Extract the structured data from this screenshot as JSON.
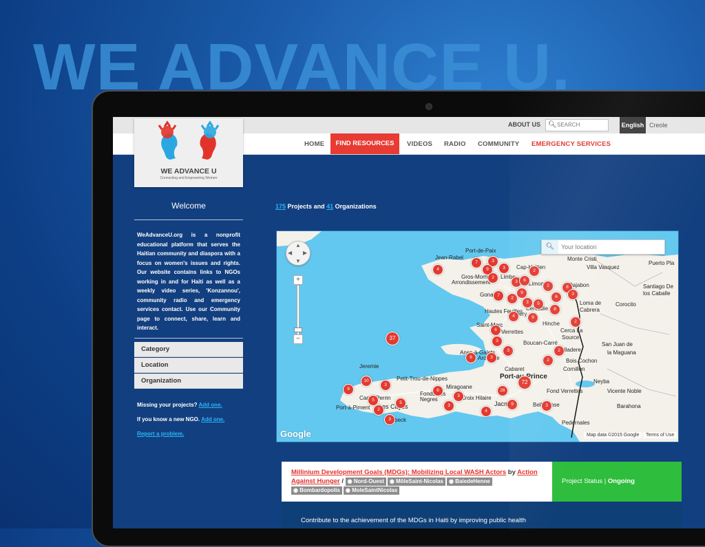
{
  "hero": "WE ADVANCE U.",
  "top_links": {
    "about": "ABOUT US",
    "search_placeholder": "SEARCH"
  },
  "lang": {
    "english": "English",
    "creole": "Creole"
  },
  "nav": [
    "HOME",
    "FIND RESOURCES",
    "VIDEOS",
    "RADIO",
    "COMMUNITY",
    "EMERGENCY SERVICES"
  ],
  "logo": {
    "title": "WE ADVANCE U",
    "tagline": "Connecting and Empowering Women"
  },
  "sidebar": {
    "welcome": "Welcome",
    "about": "WeAdvanceU.org is a nonprofit educational platform that serves the Haitian community and diaspora with a focus on women's issues and rights. Our website contains links to NGOs working in and for Haiti as well as a weekly video series, 'Konzannou', community radio and emergency services contact. Use our Community page to connect, share, learn and interact.",
    "filters": [
      "Category",
      "Location",
      "Organization"
    ],
    "missing_text": "Missing your projects?",
    "add_one": "Add one.",
    "new_ngo_text": "If you know a new NGO.",
    "report": "Report a problem."
  },
  "counts": {
    "projects": "175",
    "projects_label": "Projects and",
    "orgs": "41",
    "orgs_label": "Organizations"
  },
  "map": {
    "search_placeholder": "Your location",
    "google": "Google",
    "attribution": "Map data ©2015 Google",
    "terms": "Terms of Use",
    "places": [
      "Port-de-Paix",
      "Jean-Rabel",
      "Cap-Haitien",
      "Monte Cristi",
      "Puerto Pla",
      "Villa Vasquez",
      "Gros-Morne",
      "Limbe",
      "Arrondissement",
      "Gonaives",
      "Limonade",
      "Dajabon",
      "Santiago De",
      "los Caballe",
      "Hautes Feuilles",
      "Ennery",
      "Cercadie",
      "Corocito",
      "Saint-Marc",
      "Hinche",
      "Loma de",
      "Cabrera",
      "Verrettes",
      "Cerca La",
      "Source",
      "Boucan-Carré",
      "Anse-à-Galets",
      "Arcahaie",
      "Belladere",
      "San Juan de",
      "la Maguana",
      "Cabaret",
      "Bois Cochon",
      "Jeremie",
      "Port-au-Prince",
      "Cornillon",
      "Petit-Trou-de-Nippes",
      "Neyba",
      "Fonds des",
      "Negres",
      "Miragoane",
      "Fond Verrettes",
      "Vicente Noble",
      "Camp-Perrin",
      "Croix Hilaire",
      "Port-à-Piment",
      "Les Cayes",
      "Jacmel",
      "Belle-Anse",
      "Barahona",
      "Torbeck",
      "Pedernales"
    ],
    "clusters": [
      "37",
      "72",
      "28",
      "4",
      "7",
      "3",
      "9",
      "3",
      "2",
      "3",
      "6",
      "2",
      "2",
      "8",
      "3",
      "6",
      "9",
      "2",
      "7",
      "3",
      "5",
      "8",
      "9",
      "4",
      "2",
      "6",
      "3",
      "2",
      "3",
      "3",
      "2",
      "6",
      "10",
      "3",
      "5",
      "6",
      "3",
      "5",
      "9",
      "2",
      "3",
      "4",
      "3",
      "9",
      "3"
    ]
  },
  "project": {
    "title": "Millinium Development Goals (MDGs): Mobilizing Local WASH Actors",
    "by": "by",
    "org": "Action Against Hunger",
    "slash": "/",
    "tags": [
      "Nord-Ouest",
      "MôleSaint-Nicolas",
      "BaiedeHenne",
      "Bombardopolis",
      "MoleSaintNicolas"
    ],
    "status_label": "Project Status |",
    "status_value": "Ongoing",
    "description": "Contribute to the achievement of the MDGs in Haiti by improving public health"
  },
  "colors": {
    "accent_red": "#e73b33",
    "link_blue": "#29b6f6",
    "status_green": "#2ebd3c",
    "page_blue": "#123f7f"
  }
}
